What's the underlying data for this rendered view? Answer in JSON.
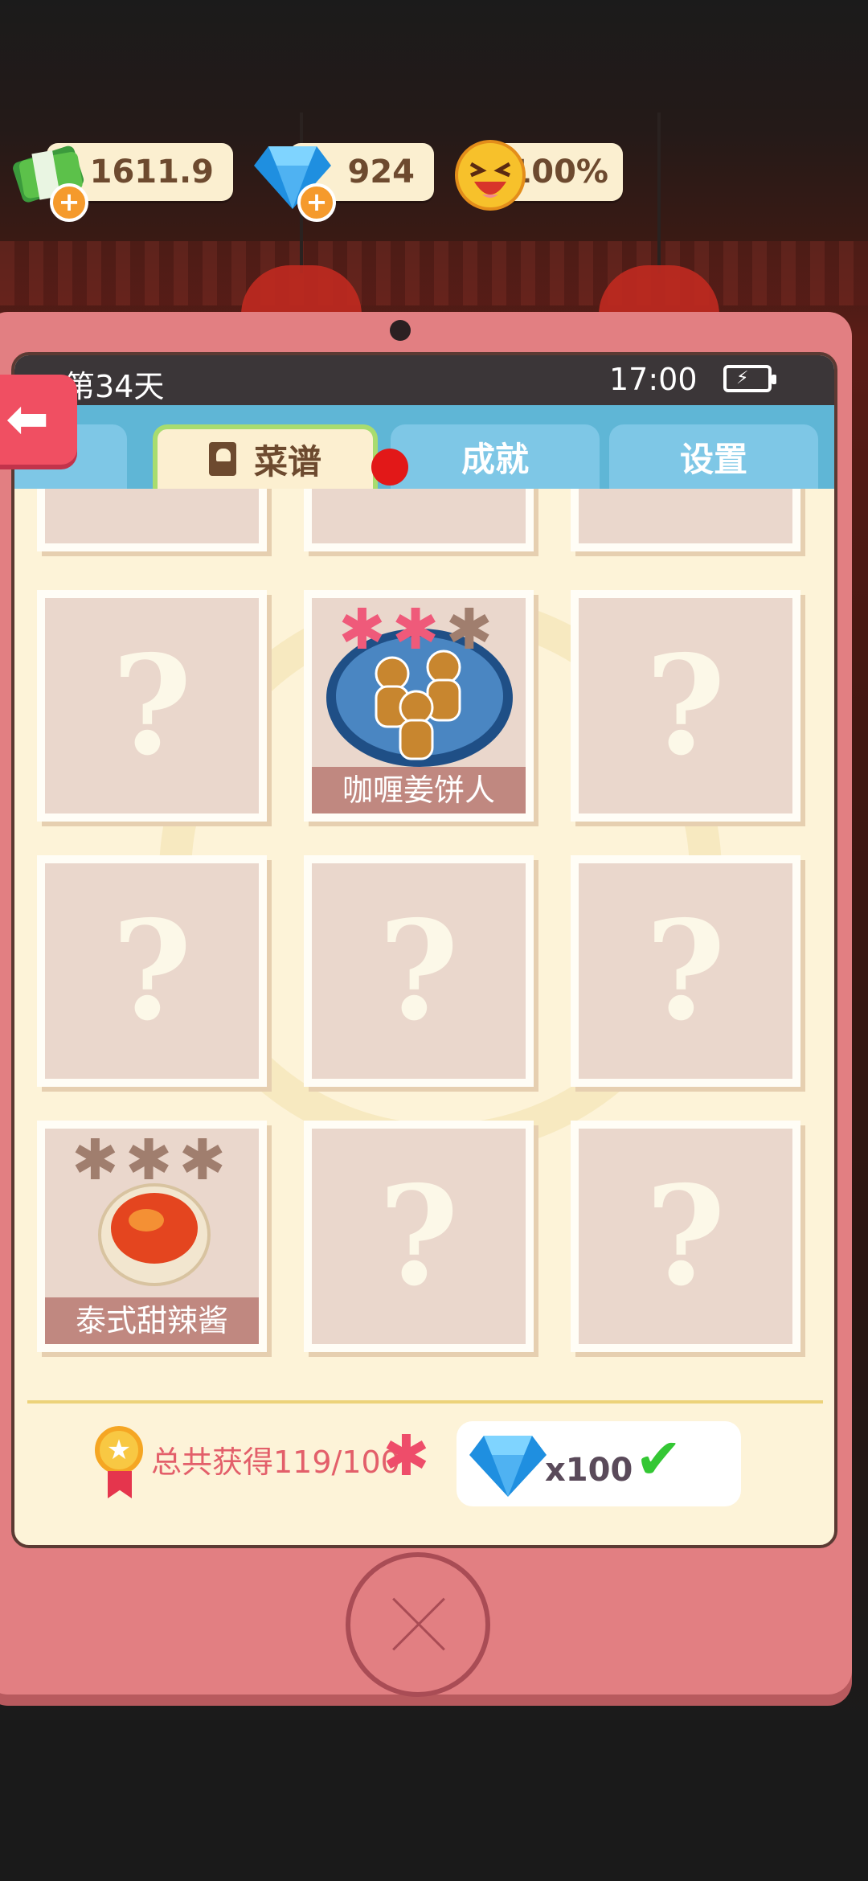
{
  "hud": {
    "cash": "1611.9",
    "gems": "924",
    "mood": "100%"
  },
  "status_bar": {
    "day": "第34天",
    "time": "17:00"
  },
  "tabs": {
    "recipes": "菜谱",
    "achievements": "成就",
    "settings": "设置"
  },
  "recipes": {
    "unknown_symbol": "?",
    "dish_1": "咖喱姜饼人",
    "dish_2": "泰式甜辣酱",
    "star_glyph": "✱"
  },
  "reward": {
    "total_label": "总共获得119/100",
    "amount": "x100"
  },
  "colors": {
    "accent_pink": "#e27f82",
    "tab_blue": "#7ec7e6",
    "star_filled": "#ef5a7a",
    "star_empty": "#a07e6e"
  }
}
